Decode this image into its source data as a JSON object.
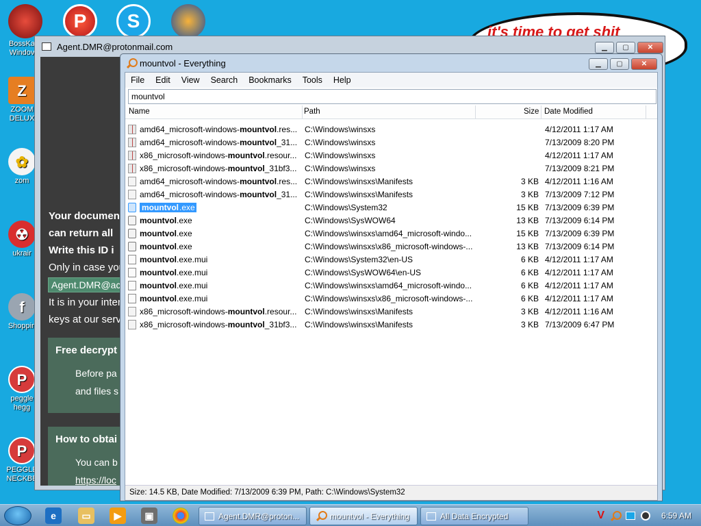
{
  "desktop": {
    "icons": [
      {
        "label": "BossKa Windov",
        "color": "#c0392b"
      },
      {
        "label": "ZOOM DELUX",
        "color": "#e67e22"
      },
      {
        "label": "zom",
        "color": "#2e86de"
      },
      {
        "label": "ukrair",
        "color": "#d92e2e"
      },
      {
        "label": "Shoppin",
        "color": "#9aa5b1"
      },
      {
        "label": "peggle hegg",
        "color": "#d63b3b"
      },
      {
        "label": "PEGGLE NECKBE",
        "color": "#d63b3b"
      }
    ],
    "top_icons": [
      "P",
      "S"
    ],
    "cloud_text": "it's time to get shit"
  },
  "ransom_window": {
    "title": "Agent.DMR@protonmail.com",
    "lines": [
      "Your documen",
      "can return all",
      "Write this ID i",
      "Only in case you",
      "It is in your inter",
      "keys at our serv"
    ],
    "email": "Agent.DMR@ac",
    "box1": {
      "heading": "Free decrypt",
      "p1": "Before pa",
      "p2": "and files s"
    },
    "box2": {
      "heading": "How to obtai",
      "p1": "You can b",
      "link": "https://loc"
    }
  },
  "everything": {
    "title": "mountvol - Everything",
    "menu": [
      "File",
      "Edit",
      "View",
      "Search",
      "Bookmarks",
      "Tools",
      "Help"
    ],
    "search_value": "mountvol",
    "columns": {
      "name": "Name",
      "path": "Path",
      "size": "Size",
      "date": "Date Modified"
    },
    "rows": [
      {
        "pre": "amd64_microsoft-windows-",
        "bold": "mountvol",
        "post": ".res...",
        "path": "C:\\Windows\\winsxs",
        "size": "",
        "date": "4/12/2011 1:17 AM",
        "icon": "ico-res",
        "selected": false
      },
      {
        "pre": "amd64_microsoft-windows-",
        "bold": "mountvol",
        "post": "_31...",
        "path": "C:\\Windows\\winsxs",
        "size": "",
        "date": "7/13/2009 8:20 PM",
        "icon": "ico-res",
        "selected": false
      },
      {
        "pre": "x86_microsoft-windows-",
        "bold": "mountvol",
        "post": ".resour...",
        "path": "C:\\Windows\\winsxs",
        "size": "",
        "date": "4/12/2011 1:17 AM",
        "icon": "ico-res",
        "selected": false
      },
      {
        "pre": "x86_microsoft-windows-",
        "bold": "mountvol",
        "post": "_31bf3...",
        "path": "C:\\Windows\\winsxs",
        "size": "",
        "date": "7/13/2009 8:21 PM",
        "icon": "ico-res",
        "selected": false
      },
      {
        "pre": "amd64_microsoft-windows-",
        "bold": "mountvol",
        "post": ".res...",
        "path": "C:\\Windows\\winsxs\\Manifests",
        "size": "3 KB",
        "date": "4/12/2011 1:16 AM",
        "icon": "ico-man",
        "selected": false
      },
      {
        "pre": "amd64_microsoft-windows-",
        "bold": "mountvol",
        "post": "_31...",
        "path": "C:\\Windows\\winsxs\\Manifests",
        "size": "3 KB",
        "date": "7/13/2009 7:12 PM",
        "icon": "ico-man",
        "selected": false
      },
      {
        "pre": "",
        "bold": "mountvol",
        "post": ".exe",
        "path": "C:\\Windows\\System32",
        "size": "15 KB",
        "date": "7/13/2009 6:39 PM",
        "icon": "ico-exe-sel",
        "selected": true
      },
      {
        "pre": "",
        "bold": "mountvol",
        "post": ".exe",
        "path": "C:\\Windows\\SysWOW64",
        "size": "13 KB",
        "date": "7/13/2009 6:14 PM",
        "icon": "ico-exe",
        "selected": false
      },
      {
        "pre": "",
        "bold": "mountvol",
        "post": ".exe",
        "path": "C:\\Windows\\winsxs\\amd64_microsoft-windo...",
        "size": "15 KB",
        "date": "7/13/2009 6:39 PM",
        "icon": "ico-exe",
        "selected": false
      },
      {
        "pre": "",
        "bold": "mountvol",
        "post": ".exe",
        "path": "C:\\Windows\\winsxs\\x86_microsoft-windows-...",
        "size": "13 KB",
        "date": "7/13/2009 6:14 PM",
        "icon": "ico-exe",
        "selected": false
      },
      {
        "pre": "",
        "bold": "mountvol",
        "post": ".exe.mui",
        "path": "C:\\Windows\\System32\\en-US",
        "size": "6 KB",
        "date": "4/12/2011 1:17 AM",
        "icon": "ico-mui",
        "selected": false
      },
      {
        "pre": "",
        "bold": "mountvol",
        "post": ".exe.mui",
        "path": "C:\\Windows\\SysWOW64\\en-US",
        "size": "6 KB",
        "date": "4/12/2011 1:17 AM",
        "icon": "ico-mui",
        "selected": false
      },
      {
        "pre": "",
        "bold": "mountvol",
        "post": ".exe.mui",
        "path": "C:\\Windows\\winsxs\\amd64_microsoft-windo...",
        "size": "6 KB",
        "date": "4/12/2011 1:17 AM",
        "icon": "ico-mui",
        "selected": false
      },
      {
        "pre": "",
        "bold": "mountvol",
        "post": ".exe.mui",
        "path": "C:\\Windows\\winsxs\\x86_microsoft-windows-...",
        "size": "6 KB",
        "date": "4/12/2011 1:17 AM",
        "icon": "ico-mui",
        "selected": false
      },
      {
        "pre": "x86_microsoft-windows-",
        "bold": "mountvol",
        "post": ".resour...",
        "path": "C:\\Windows\\winsxs\\Manifests",
        "size": "3 KB",
        "date": "4/12/2011 1:16 AM",
        "icon": "ico-man",
        "selected": false
      },
      {
        "pre": "x86_microsoft-windows-",
        "bold": "mountvol",
        "post": "_31bf3...",
        "path": "C:\\Windows\\winsxs\\Manifests",
        "size": "3 KB",
        "date": "7/13/2009 6:47 PM",
        "icon": "ico-man",
        "selected": false
      }
    ],
    "status": "Size: 14.5 KB, Date Modified: 7/13/2009 6:39 PM, Path: C:\\Windows\\System32"
  },
  "taskbar": {
    "buttons": [
      {
        "label": "Agent.DMR@proton...",
        "active": false
      },
      {
        "label": "mountvol - Everything",
        "active": true
      },
      {
        "label": "All Data Encrypted",
        "active": false
      }
    ],
    "clock": "6:59 AM"
  }
}
